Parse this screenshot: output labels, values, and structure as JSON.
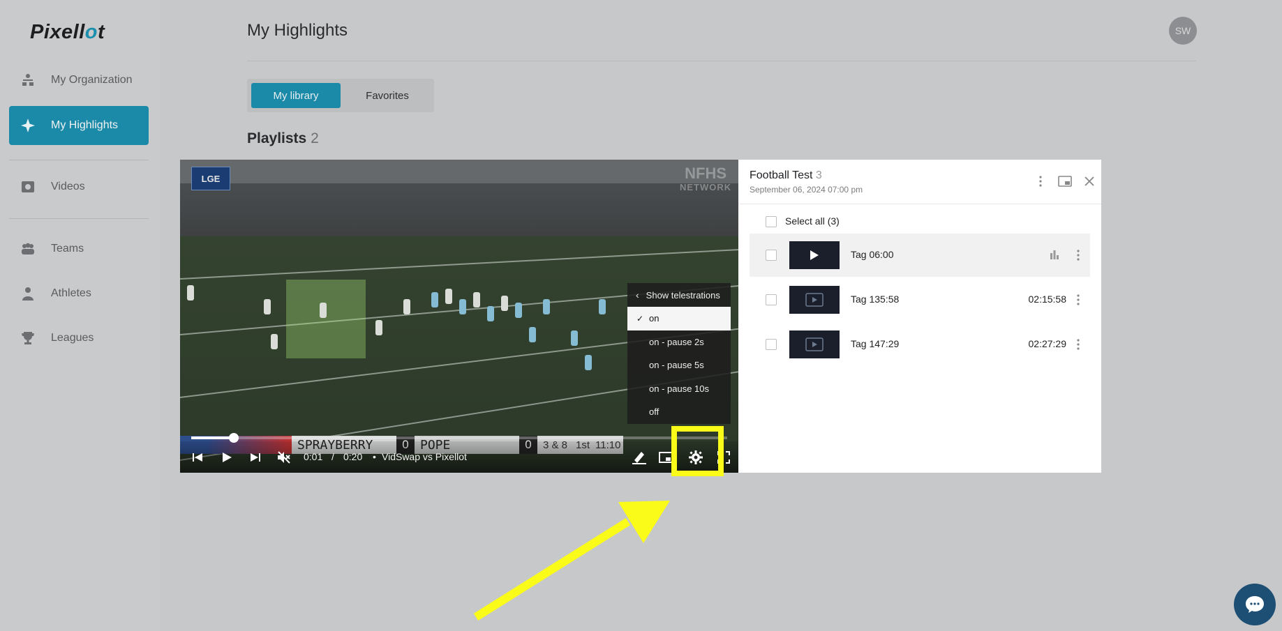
{
  "app": {
    "logo_prefix": "Pixell",
    "logo_accent": "o",
    "logo_suffix": "t"
  },
  "sidebar": {
    "items": [
      {
        "label": "My Organization",
        "icon": "organization-icon"
      },
      {
        "label": "My Highlights",
        "icon": "sparkle-icon",
        "active": true
      },
      {
        "label": "Videos",
        "icon": "video-icon"
      },
      {
        "label": "Teams",
        "icon": "teams-icon"
      },
      {
        "label": "Athletes",
        "icon": "athlete-icon"
      },
      {
        "label": "Leagues",
        "icon": "trophy-icon"
      }
    ]
  },
  "header": {
    "title": "My Highlights",
    "avatar_initials": "SW"
  },
  "tabs": [
    {
      "label": "My library",
      "active": true
    },
    {
      "label": "Favorites",
      "active": false
    }
  ],
  "playlists": {
    "title": "Playlists",
    "count": "2"
  },
  "video": {
    "broadcaster_logo": "LGE",
    "network_watermark_line1": "NFHS",
    "network_watermark_line2": "NETWORK",
    "scoreboard": {
      "team_home": "SPRAYBERRY",
      "score_home": "0",
      "team_away": "POPE",
      "score_away": "0",
      "down_distance": "3 & 8",
      "quarter": "1st",
      "clock": "11:10"
    },
    "current_time": "0:01",
    "separator": "/",
    "duration": "0:20",
    "bullet": "•",
    "title": "VidSwap vs Pixellot",
    "progress": 0.08
  },
  "settings_menu": {
    "header": "Show telestrations",
    "options": [
      {
        "label": "on",
        "selected": true
      },
      {
        "label": "on - pause 2s",
        "selected": false
      },
      {
        "label": "on - pause 5s",
        "selected": false
      },
      {
        "label": "on - pause 10s",
        "selected": false
      },
      {
        "label": "off",
        "selected": false
      }
    ],
    "check_glyph": "✓"
  },
  "playlist_panel": {
    "title": "Football Test",
    "count": "3",
    "date": "September 06, 2024 07:00 pm",
    "select_all": "Select all (3)",
    "items": [
      {
        "label": "Tag 06:00",
        "time": "",
        "active": true
      },
      {
        "label": "Tag 135:58",
        "time": "02:15:58",
        "active": false
      },
      {
        "label": "Tag 147:29",
        "time": "02:27:29",
        "active": false
      }
    ]
  },
  "colors": {
    "accent": "#1a8aa8",
    "annotation_yellow": "#fbfb19",
    "chat_bubble": "#1d4e73"
  }
}
